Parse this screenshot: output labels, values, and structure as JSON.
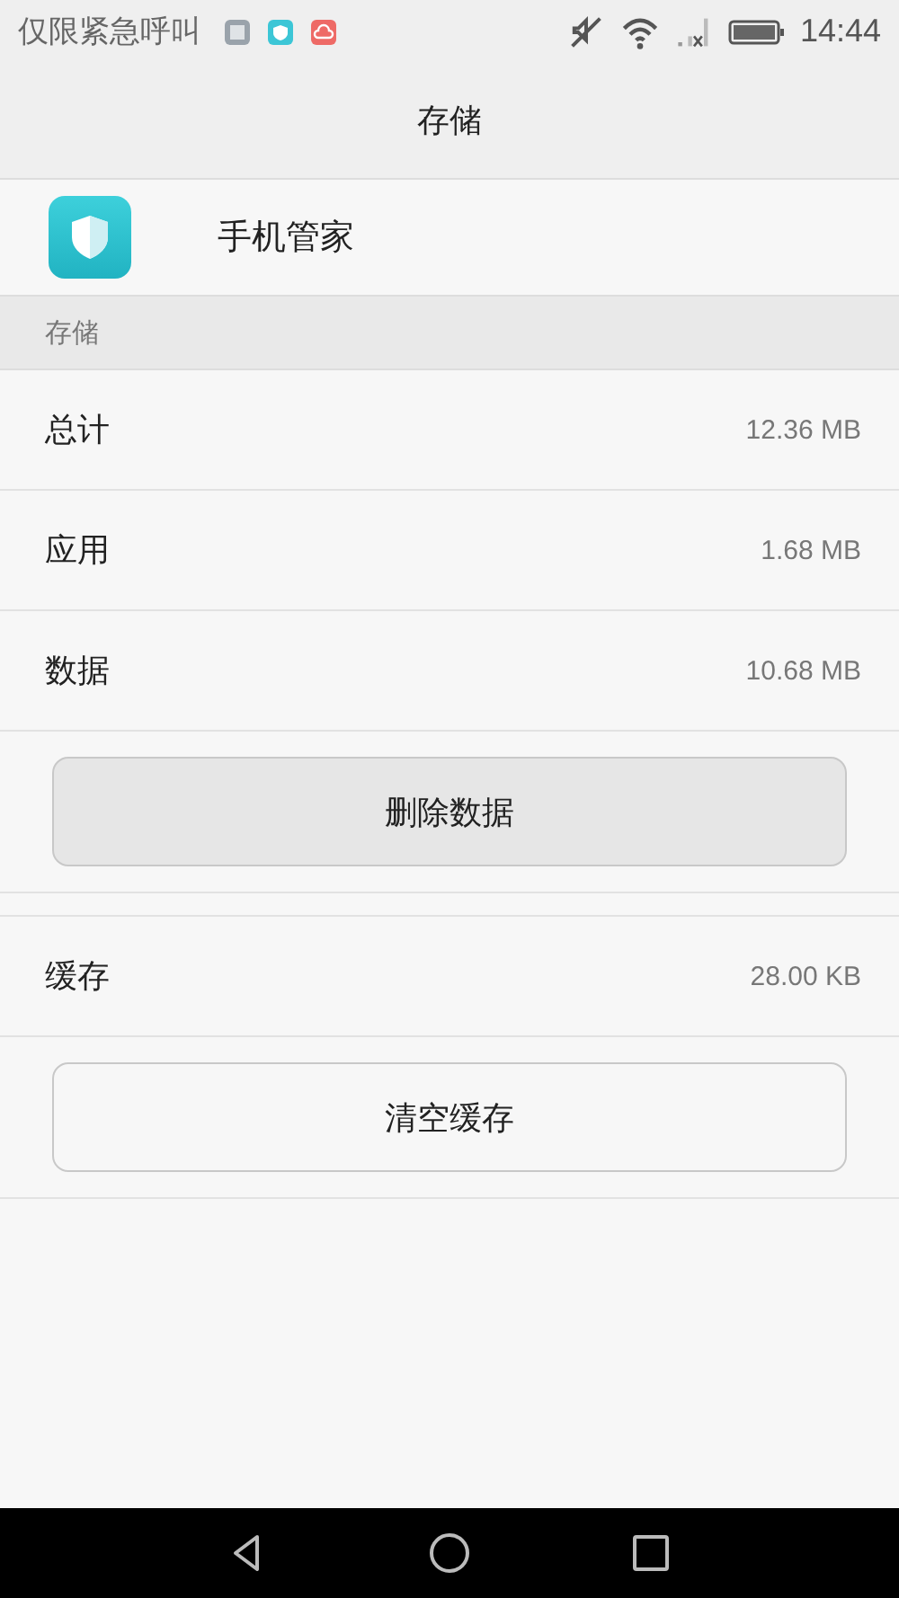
{
  "status_bar": {
    "carrier": "仅限紧急呼叫",
    "time": "14:44"
  },
  "header": {
    "title": "存储"
  },
  "app": {
    "name": "手机管家"
  },
  "section": {
    "title": "存储"
  },
  "storage_rows": [
    {
      "label": "总计",
      "value": "12.36 MB"
    },
    {
      "label": "应用",
      "value": "1.68 MB"
    },
    {
      "label": "数据",
      "value": "10.68 MB"
    }
  ],
  "clear_data_button": "删除数据",
  "cache_row": {
    "label": "缓存",
    "value": "28.00 KB"
  },
  "clear_cache_button": "清空缓存"
}
